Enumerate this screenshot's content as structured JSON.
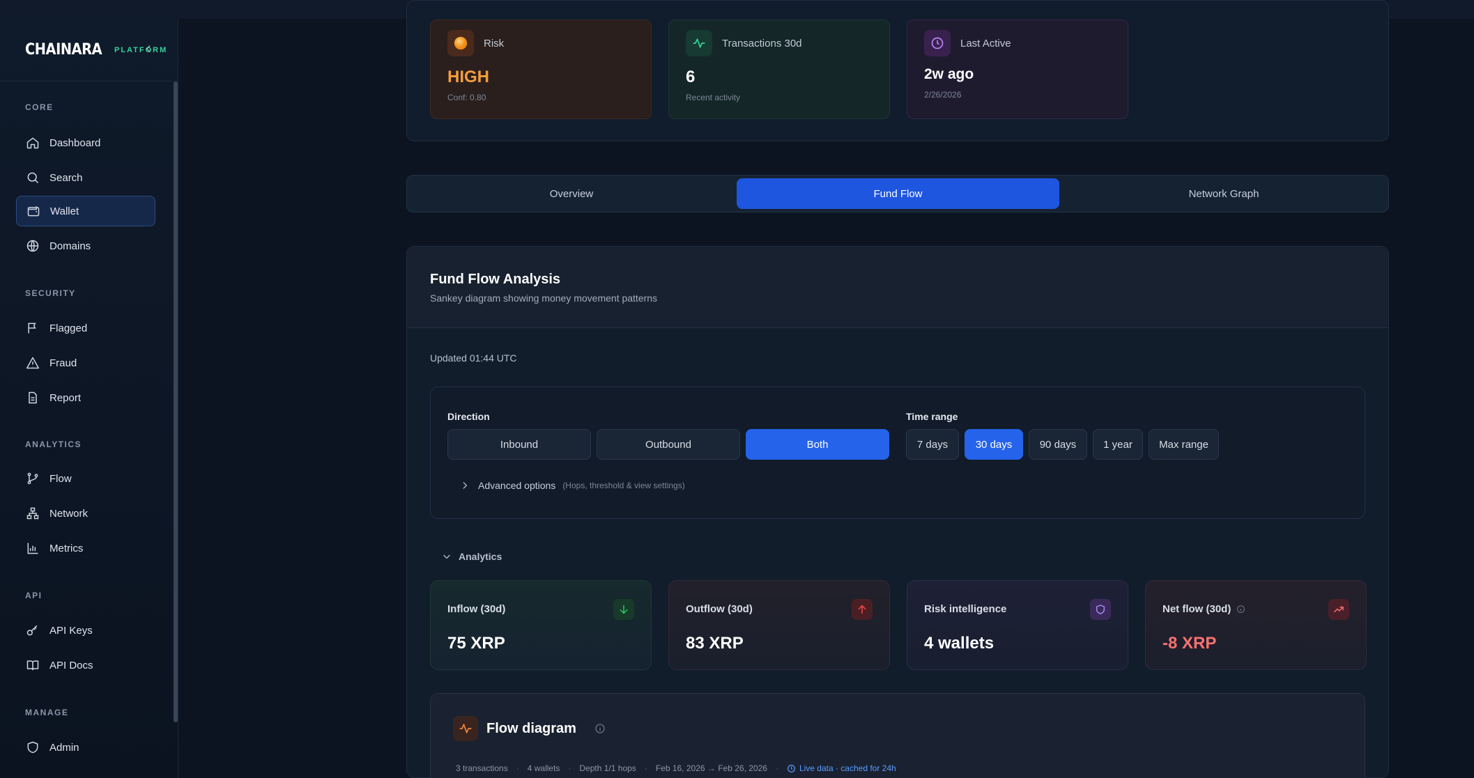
{
  "brand": {
    "name": "CHAINARA",
    "tag": "PLATFORM"
  },
  "sidebar": {
    "sections": [
      {
        "title": "CORE",
        "items": [
          "Dashboard",
          "Search",
          "Wallet",
          "Domains"
        ]
      },
      {
        "title": "SECURITY",
        "items": [
          "Flagged",
          "Fraud",
          "Report"
        ]
      },
      {
        "title": "ANALYTICS",
        "items": [
          "Flow",
          "Network",
          "Metrics"
        ]
      },
      {
        "title": "API",
        "items": [
          "API Keys",
          "API Docs"
        ]
      },
      {
        "title": "MANAGE",
        "items": [
          "Admin"
        ]
      }
    ],
    "active": "Wallet"
  },
  "stats": [
    {
      "label": "Risk",
      "value": "HIGH",
      "sub": "Conf: 0.80",
      "value_color": "#f59e3b"
    },
    {
      "label": "Transactions 30d",
      "value": "6",
      "sub": "Recent activity"
    },
    {
      "label": "Last Active",
      "value": "2w ago",
      "sub": "2/26/2026"
    }
  ],
  "tabs": [
    "Overview",
    "Fund Flow",
    "Network Graph"
  ],
  "active_tab": "Fund Flow",
  "panel": {
    "title": "Fund Flow Analysis",
    "subtitle": "Sankey diagram showing money movement patterns",
    "updated": "Updated 01:44 UTC"
  },
  "controls": {
    "direction_label": "Direction",
    "direction_options": [
      "Inbound",
      "Outbound",
      "Both"
    ],
    "direction_selected": "Both",
    "time_label": "Time range",
    "time_options": [
      "7 days",
      "30 days",
      "90 days",
      "1 year",
      "Max range"
    ],
    "time_selected": "30 days",
    "advanced_label": "Advanced options",
    "advanced_hint": "(Hops, threshold & view settings)"
  },
  "analytics": {
    "toggle_label": "Analytics",
    "metrics": [
      {
        "label": "Inflow (30d)",
        "value": "75 XRP",
        "icon": "arrow-down-icon",
        "accent": "#22c55e"
      },
      {
        "label": "Outflow (30d)",
        "value": "83 XRP",
        "icon": "arrow-up-icon",
        "accent": "#ef4444"
      },
      {
        "label": "Risk intelligence",
        "value": "4 wallets",
        "icon": "shield-icon",
        "accent": "#a78bfa"
      },
      {
        "label": "Net flow (30d)",
        "value": "-8 XRP",
        "icon": "trending-up-icon",
        "accent": "#f87171"
      }
    ]
  },
  "flow": {
    "title": "Flow diagram",
    "meta": [
      "3 transactions",
      "4 wallets",
      "Depth 1/1 hops",
      "Feb 16, 2026 → Feb 26, 2026"
    ],
    "live": "Live data · cached for 24h"
  }
}
